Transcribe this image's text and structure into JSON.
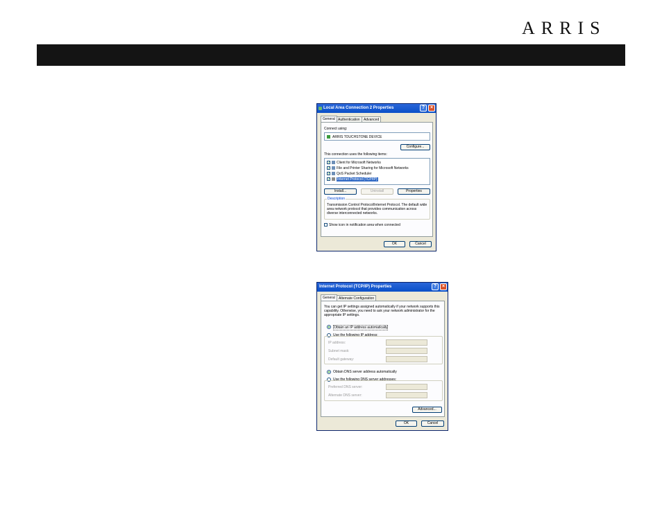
{
  "brand": {
    "logo": "ARRIS"
  },
  "dialog1": {
    "title": "Local Area Connection 2 Properties",
    "tabs": [
      "General",
      "Authentication",
      "Advanced"
    ],
    "connect_using_label": "Connect using:",
    "device": "ARRIS TOUCHSTONE DEVICE",
    "configure_label": "Configure...",
    "items_label": "This connection uses the following items:",
    "items": [
      "Client for Microsoft Networks",
      "File and Printer Sharing for Microsoft Networks",
      "QoS Packet Scheduler",
      "Internet Protocol (TCP/IP)"
    ],
    "install_label": "Install...",
    "uninstall_label": "Uninstall",
    "properties_label": "Properties",
    "description_label": "Description",
    "description_text": "Transmission Control Protocol/Internet Protocol. The default wide area network protocol that provides communication across diverse interconnected networks.",
    "show_icon_label": "Show icon in notification area when connected",
    "ok_label": "OK",
    "cancel_label": "Cancel"
  },
  "dialog2": {
    "title": "Internet Protocol (TCP/IP) Properties",
    "tabs": [
      "General",
      "Alternate Configuration"
    ],
    "intro_text": "You can get IP settings assigned automatically if your network supports this capability. Otherwise, you need to ask your network administrator for the appropriate IP settings.",
    "obtain_ip_label": "Obtain an IP address automatically",
    "use_ip_label": "Use the following IP address:",
    "ip_address_label": "IP address:",
    "subnet_mask_label": "Subnet mask:",
    "default_gateway_label": "Default gateway:",
    "obtain_dns_label": "Obtain DNS server address automatically",
    "use_dns_label": "Use the following DNS server addresses:",
    "preferred_dns_label": "Preferred DNS server:",
    "alternate_dns_label": "Alternate DNS server:",
    "advanced_label": "Advanced...",
    "ok_label": "OK",
    "cancel_label": "Cancel"
  }
}
